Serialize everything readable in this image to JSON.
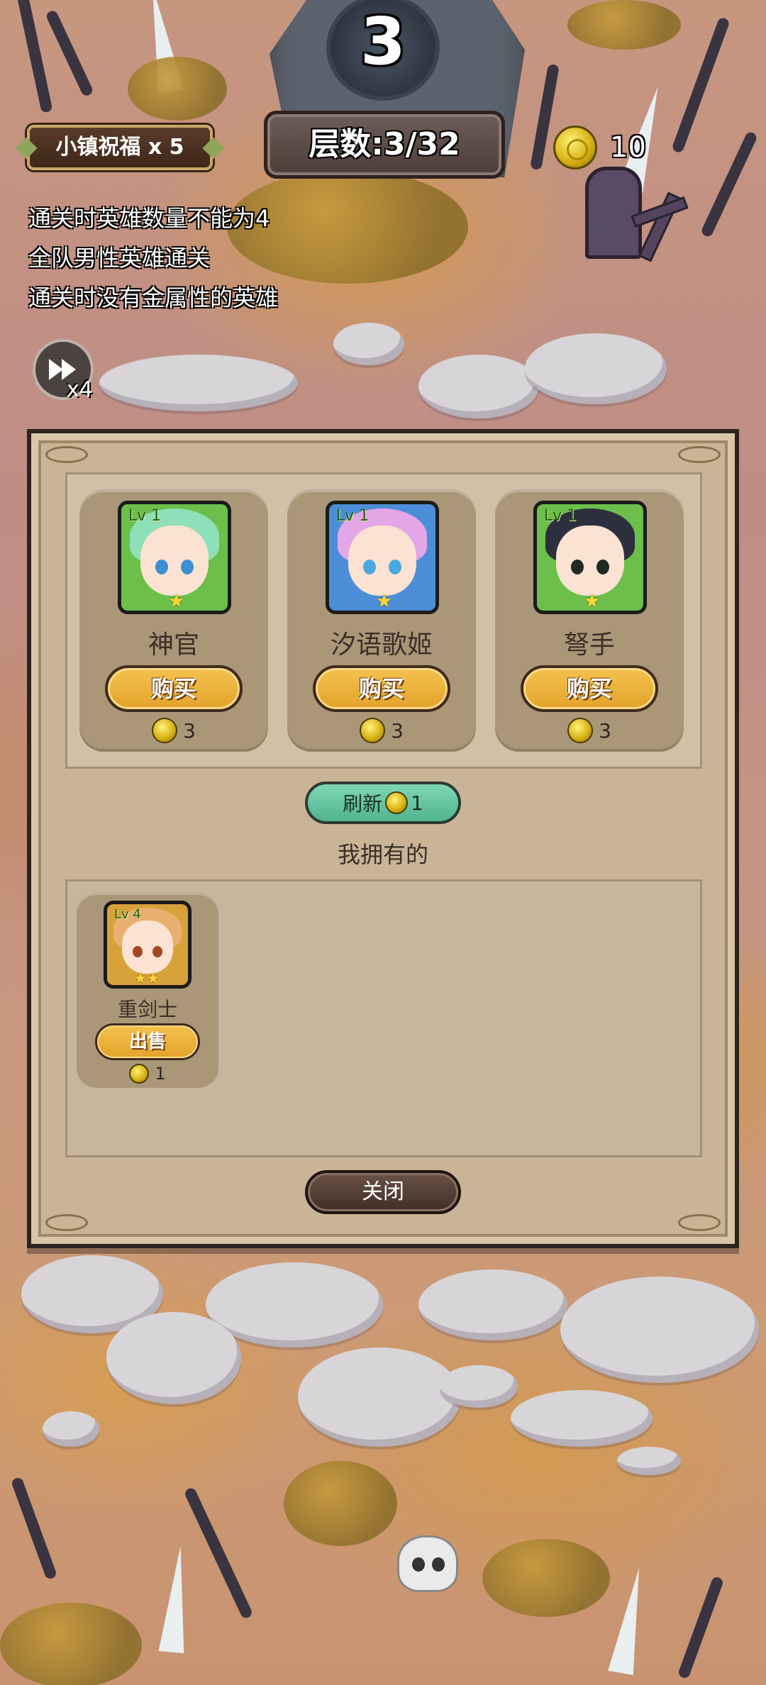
{
  "stage": {
    "number": "3"
  },
  "hud": {
    "blessing": "小镇祝福 x 5",
    "floor": "层数:3/32",
    "coins": "10",
    "speed_label": "x4"
  },
  "quests": [
    "通关时英雄数量不能为4",
    "全队男性英雄通关",
    "通关时没有金属性的英雄"
  ],
  "shop": {
    "heroes": [
      {
        "name": "神官",
        "level": "Lv 1",
        "stars": "★",
        "buy_label": "购买",
        "price": "3"
      },
      {
        "name": "汐语歌姬",
        "level": "Lv 1",
        "stars": "★",
        "buy_label": "购买",
        "price": "3"
      },
      {
        "name": "弩手",
        "level": "Lv 1",
        "stars": "★",
        "buy_label": "购买",
        "price": "3"
      }
    ],
    "refresh_label": "刷新",
    "refresh_cost": "1",
    "owned_title": "我拥有的",
    "owned": [
      {
        "name": "重剑士",
        "level": "Lv 4",
        "stars": "★★",
        "sell_label": "出售",
        "price": "1"
      }
    ],
    "close_label": "关闭"
  },
  "colors": {
    "coin": "#d9b315",
    "buy_button": "#f4c24e",
    "refresh_button": "#4fb48e",
    "panel": "#c9b596"
  }
}
